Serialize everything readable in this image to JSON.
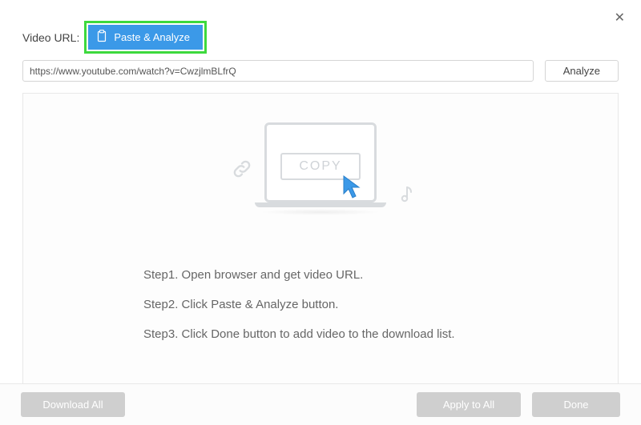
{
  "close_symbol": "✕",
  "top": {
    "url_label": "Video URL:",
    "paste_button": "Paste & Analyze"
  },
  "input": {
    "url_value": "https://www.youtube.com/watch?v=CwzjlmBLfrQ",
    "analyze_button": "Analyze"
  },
  "illustration": {
    "copy_label": "COPY"
  },
  "steps": {
    "s1": "Step1. Open browser and get video URL.",
    "s2": "Step2. Click Paste & Analyze button.",
    "s3": "Step3. Click Done button to add video to the download list."
  },
  "bottom": {
    "download_all": "Download All",
    "apply_to_all": "Apply to All",
    "done": "Done"
  }
}
